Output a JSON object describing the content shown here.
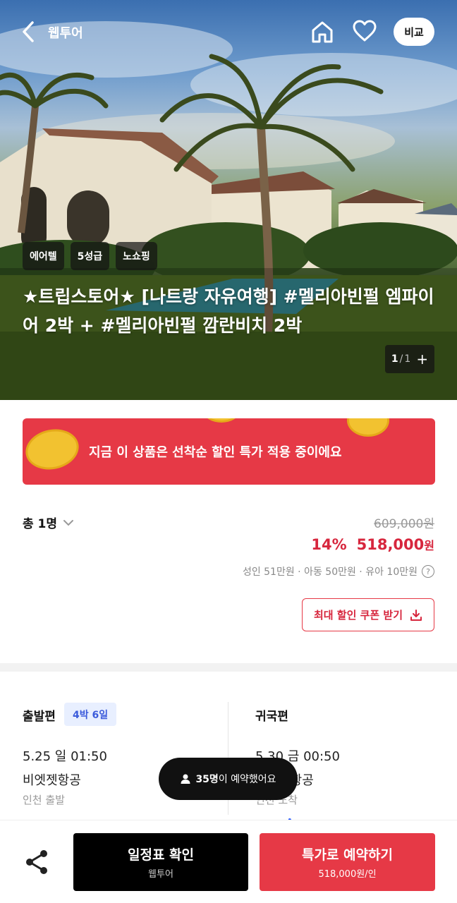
{
  "header": {
    "title": "웹투어",
    "compare_label": "비교",
    "icons": [
      "back-icon",
      "home-icon",
      "heart-icon"
    ]
  },
  "hero": {
    "tags": [
      "에어텔",
      "5성급",
      "노쇼핑"
    ],
    "title": "★트립스토어★ [나트랑 자유여행] #멜리아빈펄 엠파이어 2박 + #멜리아빈펄 깜란비치 2박",
    "pager": {
      "current": "1",
      "separator": "/",
      "total": "1",
      "plus": "+"
    }
  },
  "promo": {
    "text": "지금 이 상품은 선착순 할인 특가 적용 중이에요"
  },
  "price": {
    "people": "총 1명",
    "original": "609,000원",
    "discount_pct": "14%",
    "sale_amount": "518,000",
    "sale_unit": "원",
    "breakdown": "성인 51만원 · 아동 50만원 · 유아 10만원",
    "help_icon": "?",
    "coupon_label": "최대 할인 쿠폰 받기"
  },
  "flight": {
    "departure": {
      "label": "출발편",
      "nights": "4박 6일",
      "datetime": "5.25 일 01:50",
      "airline": "비엣젯항공",
      "route": "인천 출발"
    },
    "return": {
      "label": "귀국편",
      "datetime": "5.30 금 00:50",
      "airline": "비엣젯항공",
      "route": "인천 도착"
    }
  },
  "toast": {
    "count": "35명",
    "text": "이 예약했어요"
  },
  "bottom": {
    "schedule_label": "일정표 확인",
    "schedule_sub": "웹투어",
    "book_label": "특가로 예약하기",
    "book_sub": "518,000원/인"
  },
  "colors": {
    "accent": "#e63946",
    "sale_text": "#d7263d",
    "badge_bg": "#e8efff",
    "badge_text": "#3b5bdb"
  }
}
